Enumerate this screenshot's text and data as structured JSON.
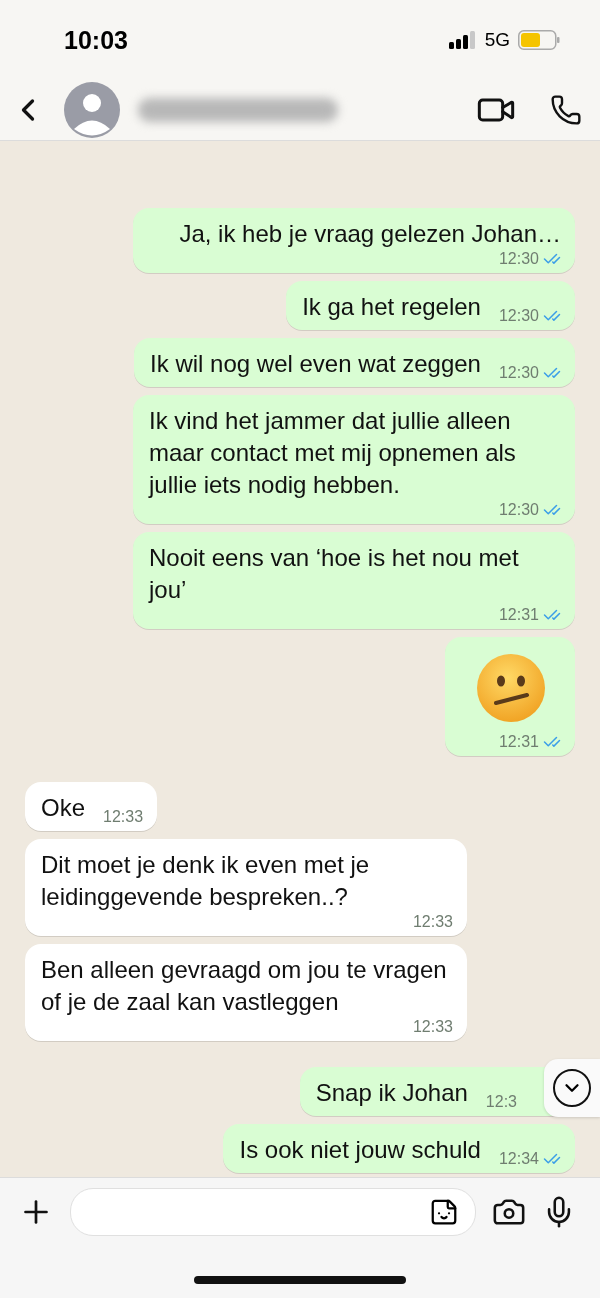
{
  "status_bar": {
    "time": "10:03",
    "network": "5G"
  },
  "messages": [
    {
      "kind": "text",
      "outgoing": true,
      "text": "Ja, ik heb je vraag gelezen Johan…",
      "time": "12:30",
      "read": true
    },
    {
      "kind": "text",
      "outgoing": true,
      "text": "Ik ga het regelen",
      "time": "12:30",
      "read": true
    },
    {
      "kind": "text",
      "outgoing": true,
      "text": "Ik wil nog wel even wat zeggen",
      "time": "12:30",
      "read": true
    },
    {
      "kind": "text",
      "outgoing": true,
      "text": "Ik vind het jammer dat jullie alleen maar contact met mij opnemen als jullie iets nodig hebben.",
      "time": "12:30",
      "read": true
    },
    {
      "kind": "text",
      "outgoing": true,
      "text": "Nooit eens van ‘hoe is het nou met jou’",
      "time": "12:31",
      "read": true
    },
    {
      "kind": "emoji",
      "outgoing": true,
      "time": "12:31",
      "read": true
    },
    {
      "kind": "text",
      "outgoing": false,
      "text": "Oke",
      "time": "12:33"
    },
    {
      "kind": "text",
      "outgoing": false,
      "text": "Dit moet je denk ik even met je leidinggevende bespreken..?",
      "time": "12:33"
    },
    {
      "kind": "text",
      "outgoing": false,
      "text": "Ben alleen gevraagd om jou te vragen of je de zaal kan vastleggen",
      "time": "12:33"
    },
    {
      "kind": "text",
      "outgoing": true,
      "text": "Snap ik Johan",
      "time": "12:3"
    },
    {
      "kind": "text",
      "outgoing": true,
      "text": "Is ook niet jouw schuld",
      "time": "12:34",
      "read": true
    }
  ]
}
